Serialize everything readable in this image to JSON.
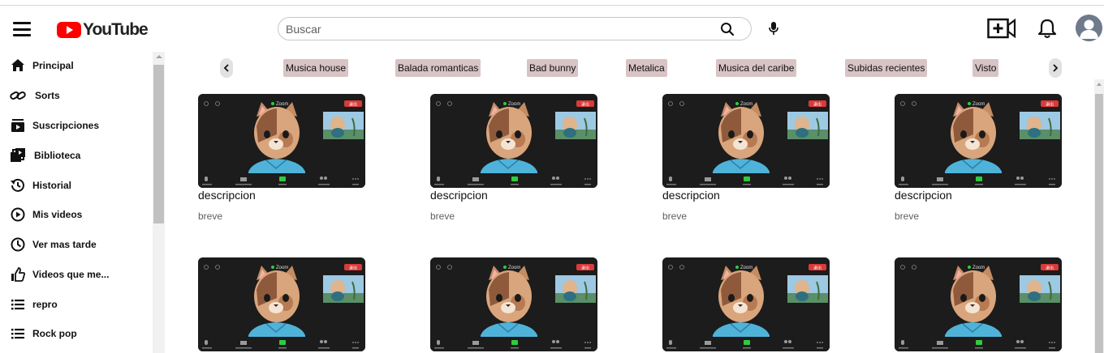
{
  "header": {
    "logo_text": "YouTube",
    "search_placeholder": "Buscar",
    "icons": [
      "menu-icon",
      "search-icon",
      "mic-icon",
      "create-video-icon",
      "bell-icon",
      "avatar-icon"
    ]
  },
  "sidebar": {
    "items": [
      {
        "label": "Principal",
        "icon": "home-icon"
      },
      {
        "label": "Sorts",
        "icon": "link-icon"
      },
      {
        "label": "Suscripciones",
        "icon": "subscriptions-icon"
      },
      {
        "label": "Biblioteca",
        "icon": "library-icon"
      },
      {
        "label": "Historial",
        "icon": "history-icon"
      },
      {
        "label": "Mis videos",
        "icon": "play-circle-icon"
      },
      {
        "label": "Ver mas tarde",
        "icon": "clock-icon"
      },
      {
        "label": "Videos que me...",
        "icon": "thumbs-up-icon"
      },
      {
        "label": "repro",
        "icon": "playlist-icon"
      },
      {
        "label": "Rock pop",
        "icon": "playlist-icon"
      }
    ]
  },
  "chips": {
    "items": [
      "Musica house",
      "Balada romanticas",
      "Bad bunny",
      "Metalica",
      "Musica del caribe",
      "Subidas recientes",
      "Visto"
    ]
  },
  "videos": [
    {
      "title": "descripcion",
      "subtitle": "breve",
      "zoom_label": "Zoom",
      "leave_label": "退出"
    },
    {
      "title": "descripcion",
      "subtitle": "breve",
      "zoom_label": "Zoom",
      "leave_label": "退出"
    },
    {
      "title": "descripcion",
      "subtitle": "breve",
      "zoom_label": "Zoom",
      "leave_label": "退出"
    },
    {
      "title": "descripcion",
      "subtitle": "breve",
      "zoom_label": "Zoom",
      "leave_label": "退出"
    },
    {
      "title": "",
      "subtitle": "",
      "zoom_label": "Zoom",
      "leave_label": "退出"
    },
    {
      "title": "",
      "subtitle": "",
      "zoom_label": "Zoom",
      "leave_label": "退出"
    },
    {
      "title": "",
      "subtitle": "",
      "zoom_label": "Zoom",
      "leave_label": "退出"
    },
    {
      "title": "",
      "subtitle": "",
      "zoom_label": "Zoom",
      "leave_label": "退出"
    }
  ],
  "colors": {
    "brand_red": "#ff0000",
    "chip_bg": "#d8c3c5",
    "thumb_bg": "#1c1c1c",
    "cat_hoodie": "#4fb3d9"
  }
}
